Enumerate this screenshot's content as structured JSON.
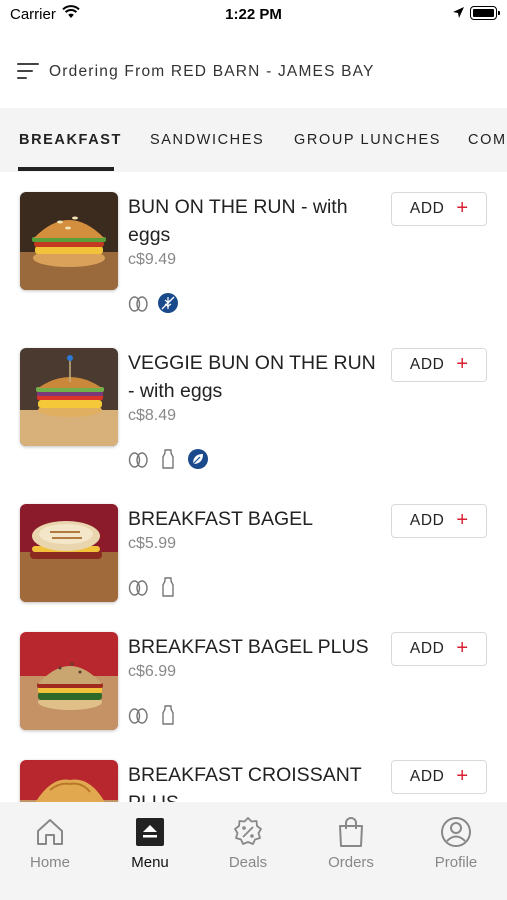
{
  "status_bar": {
    "carrier": "Carrier",
    "time": "1:22 PM"
  },
  "header": {
    "title": "Ordering From RED BARN - JAMES BAY",
    "icon": "filter-lines-icon"
  },
  "tabs": [
    {
      "label": "BREAKFAST",
      "active": true
    },
    {
      "label": "SANDWICHES",
      "active": false
    },
    {
      "label": "GROUP LUNCHES",
      "active": false
    },
    {
      "label": "COM",
      "active": false
    }
  ],
  "menu_items": [
    {
      "name": "BUN ON THE RUN - with eggs",
      "price": "c$9.49",
      "add_label": "ADD",
      "badges": [
        "egg-icon",
        "no-gluten-badge-icon"
      ]
    },
    {
      "name": "VEGGIE BUN ON THE RUN - with eggs",
      "price": "c$8.49",
      "add_label": "ADD",
      "badges": [
        "egg-icon",
        "milk-bottle-icon",
        "vegetarian-leaf-badge-icon"
      ]
    },
    {
      "name": "BREAKFAST BAGEL",
      "price": "c$5.99",
      "add_label": "ADD",
      "badges": [
        "egg-icon",
        "milk-bottle-icon"
      ]
    },
    {
      "name": "BREAKFAST BAGEL PLUS",
      "price": "c$6.99",
      "add_label": "ADD",
      "badges": [
        "egg-icon",
        "milk-bottle-icon"
      ]
    },
    {
      "name": "BREAKFAST CROISSANT PLUS",
      "price": "",
      "add_label": "ADD",
      "badges": []
    }
  ],
  "bottom_nav": [
    {
      "label": "Home",
      "icon": "home-icon",
      "active": false
    },
    {
      "label": "Menu",
      "icon": "menu-icon",
      "active": true
    },
    {
      "label": "Deals",
      "icon": "percent-badge-icon",
      "active": false
    },
    {
      "label": "Orders",
      "icon": "shopping-bag-icon",
      "active": false
    },
    {
      "label": "Profile",
      "icon": "user-circle-icon",
      "active": false
    }
  ],
  "colors": {
    "accent": "#d81e2f",
    "badge_blue": "#1b4a8c",
    "tab_bg": "#f4f4f4",
    "price_gray": "#888888"
  }
}
